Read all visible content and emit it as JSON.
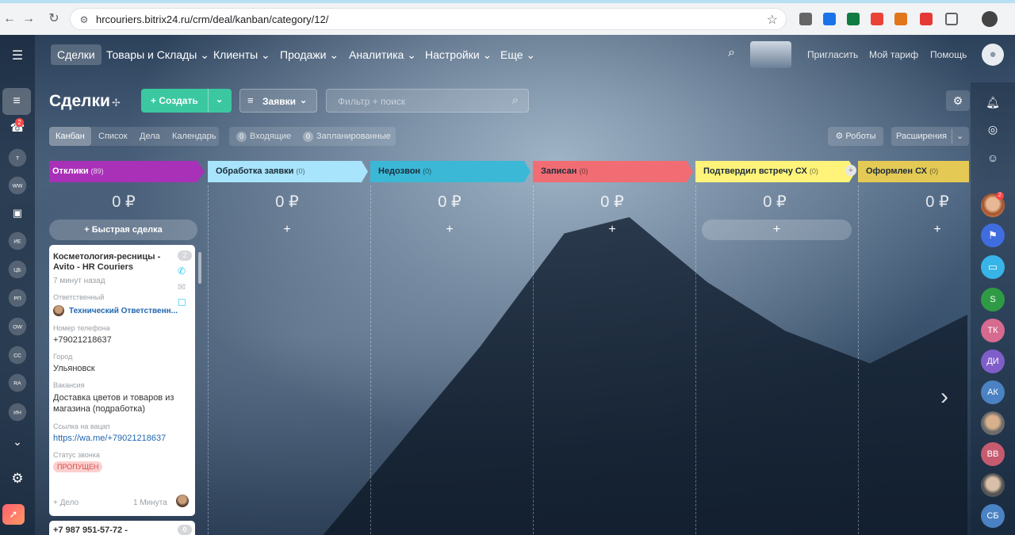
{
  "browser": {
    "url": "hrcouriers.bitrix24.ru/crm/deal/kanban/category/12/"
  },
  "topmenu": {
    "items": [
      "Сделки",
      "Товары и Склады",
      "Клиенты",
      "Продажи",
      "Аналитика",
      "Настройки",
      "Еще"
    ],
    "invite": "Пригласить",
    "tariff": "Мой тариф",
    "help": "Помощь"
  },
  "toolbar": {
    "title": "Сделки",
    "create": "Создать",
    "category": "Заявки",
    "filter_placeholder": "Фильтр + поиск",
    "robots": "Роботы",
    "extensions": "Расширения"
  },
  "views": {
    "tabs": [
      "Канбан",
      "Список",
      "Дела",
      "Календарь"
    ],
    "incoming_count": "0",
    "incoming_label": "Входящие",
    "planned_count": "0",
    "planned_label": "Запланированные"
  },
  "left_rail": {
    "notif_count": "2",
    "groups": [
      "T",
      "WW",
      "ИЕ",
      "ЦБ",
      "РП",
      "OW",
      "CC",
      "RA",
      "ИН"
    ]
  },
  "right_rail": {
    "badge": "2",
    "contacts": [
      "S",
      "ТК",
      "ДИ",
      "АК",
      "ВВ",
      "СБ"
    ]
  },
  "stages": [
    {
      "name": "Отклики",
      "count": "(89)",
      "sum": "0 ₽",
      "color": "#a831b8"
    },
    {
      "name": "Обработка заявки",
      "count": "(0)",
      "sum": "0 ₽",
      "color": "#a8e4fb"
    },
    {
      "name": "Недозвон",
      "count": "(0)",
      "sum": "0 ₽",
      "color": "#3bb8d6"
    },
    {
      "name": "Записан",
      "count": "(0)",
      "sum": "0 ₽",
      "color": "#f16d73"
    },
    {
      "name": "Подтвердил встречу СХ",
      "count": "(0)",
      "sum": "0 ₽",
      "color": "#fff37a"
    },
    {
      "name": "Оформлен СХ",
      "count": "(0)",
      "sum": "0 ₽",
      "color": "#e4ca55"
    }
  ],
  "quick_deal": "Быстрая сделка",
  "card": {
    "title": "Косметология-ресницы - Avito - HR Couriers",
    "count": "2",
    "time": "7 минут назад",
    "responsible_label": "Ответственный",
    "responsible": "Технический Ответственн...",
    "phone_label": "Номер телефона",
    "phone": "+79021218637",
    "city_label": "Город",
    "city": "Ульяновск",
    "vacancy_label": "Вакансия",
    "vacancy": "Доставка цветов и товаров из магазина (подработка)",
    "whatsapp_label": "Ссылка на вацап",
    "whatsapp": "https://wa.me/+79021218637",
    "status_label": "Статус звонка",
    "status": "ПРОПУЩЕН",
    "add_activity": "+ Дело",
    "activity_time": "1 Минута"
  },
  "card2": {
    "title": "+7 987 951-57-72 -",
    "count": "0"
  }
}
